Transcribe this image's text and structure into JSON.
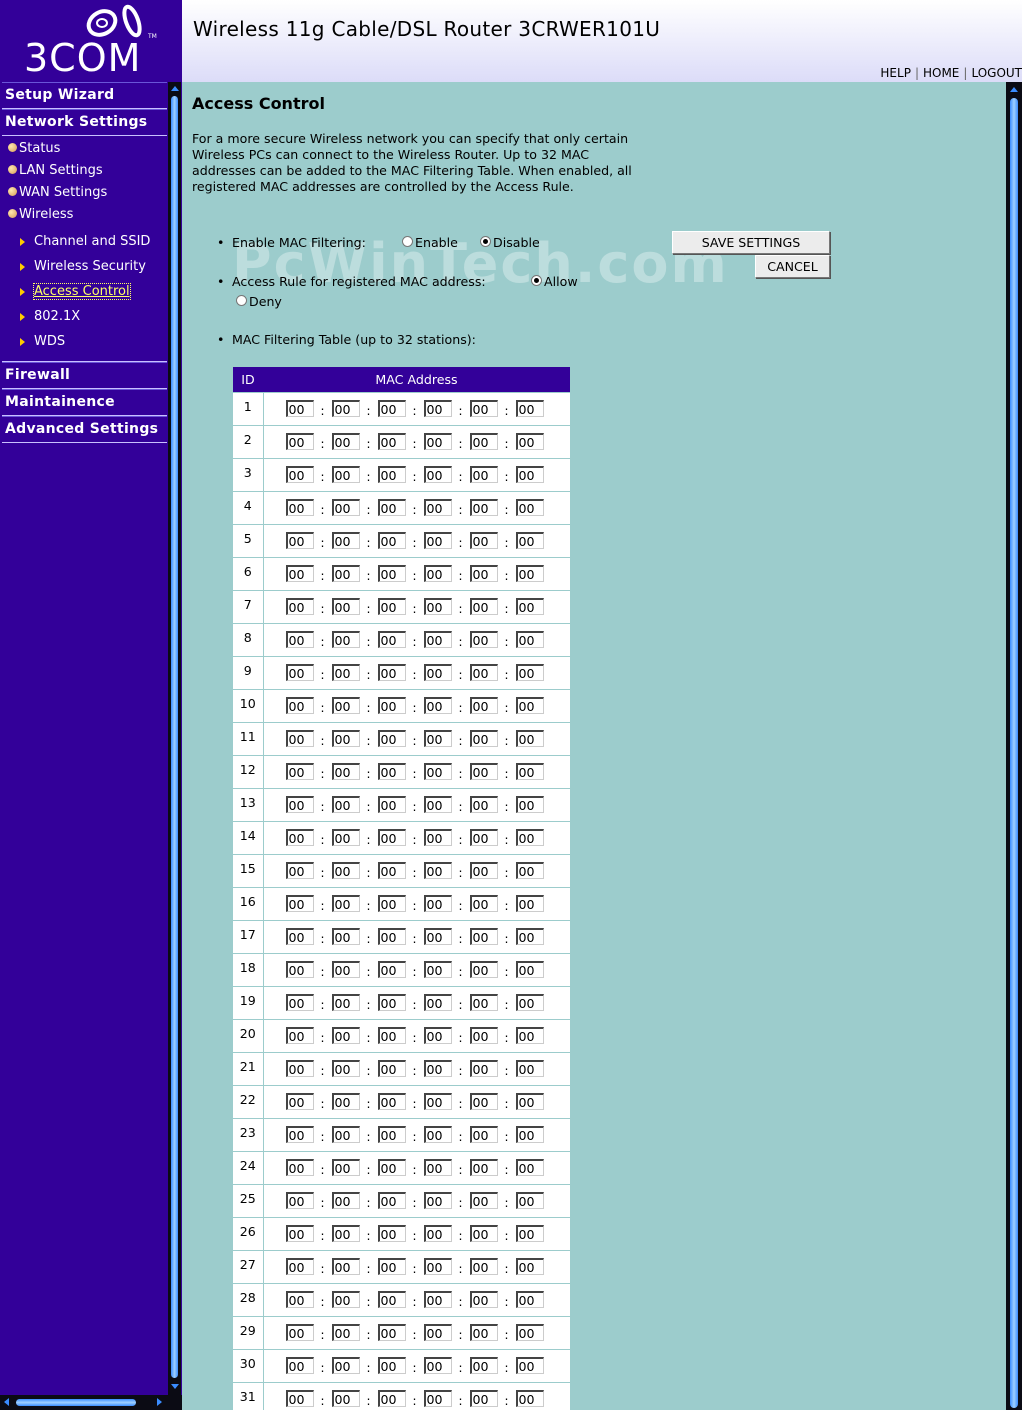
{
  "brand": {
    "logo_text": "3COM"
  },
  "header": {
    "title": "Wireless 11g Cable/DSL Router 3CRWER101U"
  },
  "top_links": [
    "HELP",
    "HOME",
    "LOGOUT"
  ],
  "nav": {
    "setup_wizard": "Setup Wizard",
    "network_settings": "Network Settings",
    "sub_items": [
      "Status",
      "LAN Settings",
      "WAN Settings",
      "Wireless"
    ],
    "wireless_items": [
      "Channel and SSID",
      "Wireless Security",
      "Access Control",
      "802.1X",
      "WDS"
    ],
    "active_item": "Access Control",
    "firewall": "Firewall",
    "maintainence": "Maintainence",
    "advanced_settings": "Advanced Settings"
  },
  "page": {
    "title": "Access Control",
    "intro": "For a more secure Wireless network you can specify that only certain Wireless PCs can connect to the Wireless Router. Up to 32 MAC addresses can be added to the MAC Filtering Table. When enabled, all registered MAC addresses are controlled by the Access Rule.",
    "mac_filtering_label": "Enable MAC Filtering:",
    "enable_label": "Enable",
    "disable_label": "Disable",
    "mac_filtering_selected": "Disable",
    "access_rule_label": "Access Rule for registered MAC address:",
    "allow_label": "Allow",
    "deny_label": "Deny",
    "access_rule_selected": "Allow",
    "table_label": "MAC Filtering Table (up to 32 stations):",
    "save_button": "SAVE SETTINGS",
    "cancel_button": "CANCEL",
    "watermark": "PcWinTech.com"
  },
  "table": {
    "headers": [
      "ID",
      "MAC Address"
    ],
    "rows": [
      {
        "id": "1",
        "octets": [
          "00",
          "00",
          "00",
          "00",
          "00",
          "00"
        ]
      },
      {
        "id": "2",
        "octets": [
          "00",
          "00",
          "00",
          "00",
          "00",
          "00"
        ]
      },
      {
        "id": "3",
        "octets": [
          "00",
          "00",
          "00",
          "00",
          "00",
          "00"
        ]
      },
      {
        "id": "4",
        "octets": [
          "00",
          "00",
          "00",
          "00",
          "00",
          "00"
        ]
      },
      {
        "id": "5",
        "octets": [
          "00",
          "00",
          "00",
          "00",
          "00",
          "00"
        ]
      },
      {
        "id": "6",
        "octets": [
          "00",
          "00",
          "00",
          "00",
          "00",
          "00"
        ]
      },
      {
        "id": "7",
        "octets": [
          "00",
          "00",
          "00",
          "00",
          "00",
          "00"
        ]
      },
      {
        "id": "8",
        "octets": [
          "00",
          "00",
          "00",
          "00",
          "00",
          "00"
        ]
      },
      {
        "id": "9",
        "octets": [
          "00",
          "00",
          "00",
          "00",
          "00",
          "00"
        ]
      },
      {
        "id": "10",
        "octets": [
          "00",
          "00",
          "00",
          "00",
          "00",
          "00"
        ]
      },
      {
        "id": "11",
        "octets": [
          "00",
          "00",
          "00",
          "00",
          "00",
          "00"
        ]
      },
      {
        "id": "12",
        "octets": [
          "00",
          "00",
          "00",
          "00",
          "00",
          "00"
        ]
      },
      {
        "id": "13",
        "octets": [
          "00",
          "00",
          "00",
          "00",
          "00",
          "00"
        ]
      },
      {
        "id": "14",
        "octets": [
          "00",
          "00",
          "00",
          "00",
          "00",
          "00"
        ]
      },
      {
        "id": "15",
        "octets": [
          "00",
          "00",
          "00",
          "00",
          "00",
          "00"
        ]
      },
      {
        "id": "16",
        "octets": [
          "00",
          "00",
          "00",
          "00",
          "00",
          "00"
        ]
      },
      {
        "id": "17",
        "octets": [
          "00",
          "00",
          "00",
          "00",
          "00",
          "00"
        ]
      },
      {
        "id": "18",
        "octets": [
          "00",
          "00",
          "00",
          "00",
          "00",
          "00"
        ]
      },
      {
        "id": "19",
        "octets": [
          "00",
          "00",
          "00",
          "00",
          "00",
          "00"
        ]
      },
      {
        "id": "20",
        "octets": [
          "00",
          "00",
          "00",
          "00",
          "00",
          "00"
        ]
      },
      {
        "id": "21",
        "octets": [
          "00",
          "00",
          "00",
          "00",
          "00",
          "00"
        ]
      },
      {
        "id": "22",
        "octets": [
          "00",
          "00",
          "00",
          "00",
          "00",
          "00"
        ]
      },
      {
        "id": "23",
        "octets": [
          "00",
          "00",
          "00",
          "00",
          "00",
          "00"
        ]
      },
      {
        "id": "24",
        "octets": [
          "00",
          "00",
          "00",
          "00",
          "00",
          "00"
        ]
      },
      {
        "id": "25",
        "octets": [
          "00",
          "00",
          "00",
          "00",
          "00",
          "00"
        ]
      },
      {
        "id": "26",
        "octets": [
          "00",
          "00",
          "00",
          "00",
          "00",
          "00"
        ]
      },
      {
        "id": "27",
        "octets": [
          "00",
          "00",
          "00",
          "00",
          "00",
          "00"
        ]
      },
      {
        "id": "28",
        "octets": [
          "00",
          "00",
          "00",
          "00",
          "00",
          "00"
        ]
      },
      {
        "id": "29",
        "octets": [
          "00",
          "00",
          "00",
          "00",
          "00",
          "00"
        ]
      },
      {
        "id": "30",
        "octets": [
          "00",
          "00",
          "00",
          "00",
          "00",
          "00"
        ]
      },
      {
        "id": "31",
        "octets": [
          "00",
          "00",
          "00",
          "00",
          "00",
          "00"
        ]
      }
    ]
  },
  "colors": {
    "sidebar": "#330099",
    "content_bg": "#9ccccc",
    "active_link": "#ffff66",
    "scroll_thumb": "#3a8cff"
  }
}
